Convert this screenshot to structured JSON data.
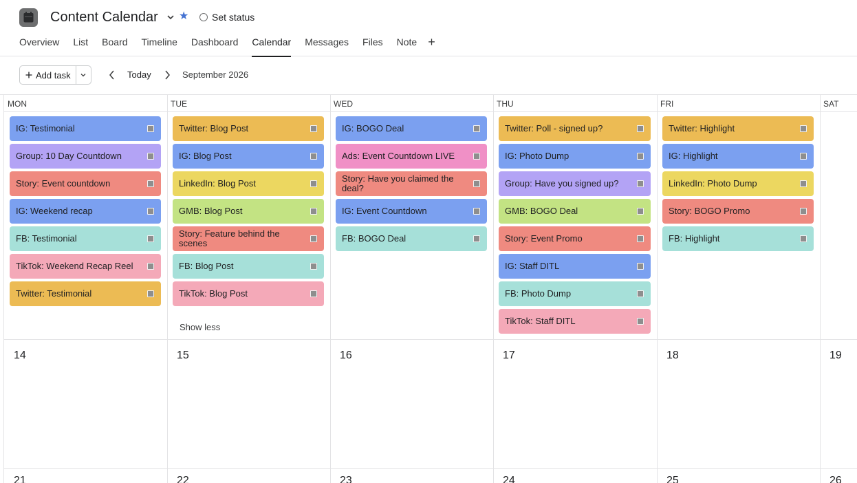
{
  "project": {
    "title": "Content Calendar",
    "set_status": "Set status"
  },
  "tabs": [
    "Overview",
    "List",
    "Board",
    "Timeline",
    "Dashboard",
    "Calendar",
    "Messages",
    "Files",
    "Note"
  ],
  "active_tab": "Calendar",
  "toolbar": {
    "add_task": "Add task",
    "today": "Today",
    "month": "September 2026"
  },
  "weekdays": [
    "MON",
    "TUE",
    "WED",
    "THU",
    "FRI",
    "SAT"
  ],
  "colors": {
    "blue": "#7ba0f0",
    "purple": "#b3a3f5",
    "red": "#ef8a80",
    "teal": "#a6e0d9",
    "pink": "#f4a9b8",
    "orange": "#ecbb54",
    "yellow": "#ecd760",
    "green": "#c3e383",
    "magenta": "#f090c6"
  },
  "week1": [
    [
      {
        "label": "IG: Testimonial",
        "color": "blue"
      },
      {
        "label": "Group: 10 Day Countdown",
        "color": "purple"
      },
      {
        "label": "Story: Event countdown",
        "color": "red"
      },
      {
        "label": "IG: Weekend recap",
        "color": "blue"
      },
      {
        "label": "FB: Testimonial",
        "color": "teal"
      },
      {
        "label": "TikTok: Weekend Recap Reel",
        "color": "pink"
      },
      {
        "label": "Twitter: Testimonial",
        "color": "orange"
      }
    ],
    [
      {
        "label": "Twitter: Blog Post",
        "color": "orange"
      },
      {
        "label": "IG: Blog Post",
        "color": "blue"
      },
      {
        "label": "LinkedIn: Blog Post",
        "color": "yellow"
      },
      {
        "label": "GMB: Blog Post",
        "color": "green"
      },
      {
        "label": "Story: Feature behind the scenes",
        "color": "red"
      },
      {
        "label": "FB: Blog Post",
        "color": "teal"
      },
      {
        "label": "TikTok: Blog Post",
        "color": "pink"
      }
    ],
    [
      {
        "label": "IG: BOGO Deal",
        "color": "blue"
      },
      {
        "label": "Ads: Event Countdown LIVE",
        "color": "magenta"
      },
      {
        "label": "Story: Have you claimed the deal?",
        "color": "red"
      },
      {
        "label": "IG: Event Countdown",
        "color": "blue"
      },
      {
        "label": "FB: BOGO Deal",
        "color": "teal"
      }
    ],
    [
      {
        "label": "Twitter: Poll - signed up?",
        "color": "orange"
      },
      {
        "label": "IG: Photo Dump",
        "color": "blue"
      },
      {
        "label": "Group: Have you signed up?",
        "color": "purple"
      },
      {
        "label": "GMB: BOGO Deal",
        "color": "green"
      },
      {
        "label": "Story: Event Promo",
        "color": "red"
      },
      {
        "label": "IG: Staff DITL",
        "color": "blue"
      },
      {
        "label": "FB: Photo Dump",
        "color": "teal"
      },
      {
        "label": "TikTok: Staff DITL",
        "color": "pink"
      }
    ],
    [
      {
        "label": "Twitter: Highlight",
        "color": "orange"
      },
      {
        "label": "IG: Highlight",
        "color": "blue"
      },
      {
        "label": "LinkedIn: Photo Dump",
        "color": "yellow"
      },
      {
        "label": "Story: BOGO Promo",
        "color": "red"
      },
      {
        "label": "FB: Highlight",
        "color": "teal"
      }
    ],
    []
  ],
  "show_less": "Show less",
  "week2_dates": [
    "14",
    "15",
    "16",
    "17",
    "18",
    "19"
  ],
  "week3_dates": [
    "21",
    "22",
    "23",
    "24",
    "25",
    "26"
  ]
}
